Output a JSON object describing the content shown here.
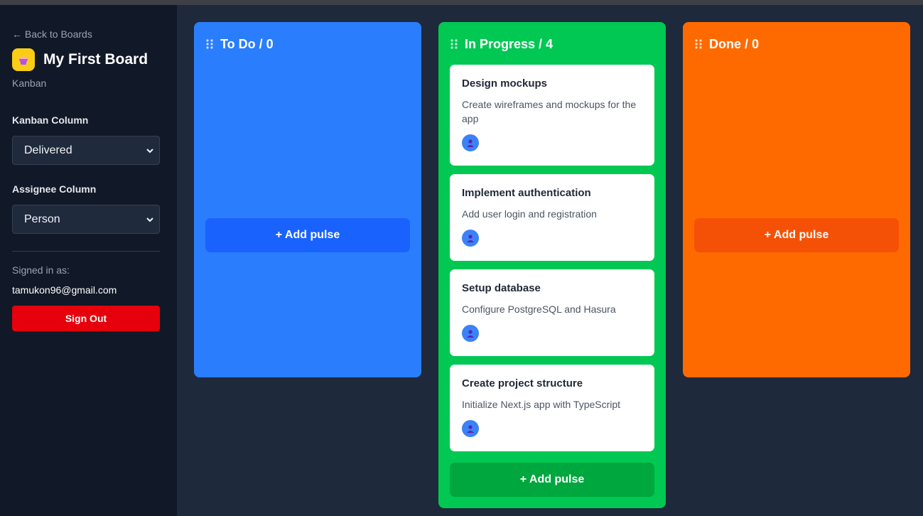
{
  "sidebar": {
    "back_label": "← Back to Boards",
    "board_icon": "cupcake-icon",
    "board_title": "My First Board",
    "board_type": "Kanban",
    "kanban_column_label": "Kanban Column",
    "kanban_column_value": "Delivered",
    "assignee_column_label": "Assignee Column",
    "assignee_column_value": "Person",
    "signed_in_label": "Signed in as:",
    "email": "tamukon96@gmail.com",
    "sign_out_label": "Sign Out"
  },
  "columns": [
    {
      "title": "To Do / 0",
      "color": "#2a7efe",
      "button_color": "#1a62fd",
      "add_label": "+ Add pulse",
      "cards": []
    },
    {
      "title": "In Progress / 4",
      "color": "#00c853",
      "button_color": "#00a63e",
      "add_label": "+ Add pulse",
      "cards": [
        {
          "title": "Design mockups",
          "description": "Create wireframes and mockups for the app"
        },
        {
          "title": "Implement authentication",
          "description": "Add user login and registration"
        },
        {
          "title": "Setup database",
          "description": "Configure PostgreSQL and Hasura"
        },
        {
          "title": "Create project structure",
          "description": "Initialize Next.js app with TypeScript"
        }
      ]
    },
    {
      "title": "Done / 0",
      "color": "#ff6a00",
      "button_color": "#f55106",
      "add_label": "+ Add pulse",
      "cards": []
    }
  ]
}
